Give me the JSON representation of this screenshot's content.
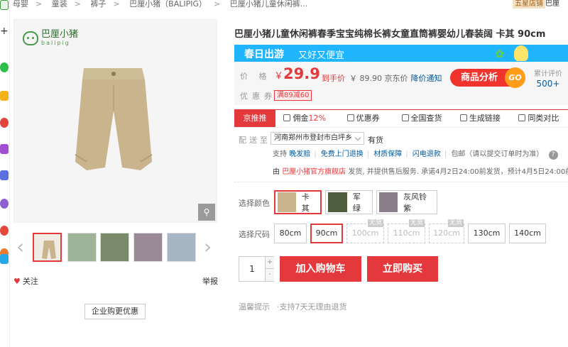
{
  "breadcrumb": [
    "母婴",
    "童装",
    "裤子",
    "巴厘小猪（BALIPIG）",
    "巴厘小猪儿童休闲裤..."
  ],
  "shop": {
    "badge": "五星店铺",
    "name": "巴厘"
  },
  "brand_logo": {
    "cn": "巴厘小猪",
    "en": "balipig"
  },
  "product": {
    "title": "巴厘小猪儿童休闲裤春季宝宝纯棉长裤女童直筒裤婴幼儿春装阔 卡其 90cm",
    "banner_main": "春日出游",
    "banner_sub": "又好又便宜",
    "price_label": "价 格",
    "currency": "￥",
    "price": "29.9",
    "hand_price_label": "到手价",
    "jd_price": "￥ 89.90 京东价",
    "price_notify": "降价通知",
    "coupon_label": "优惠券",
    "coupon": "满89减60",
    "analysis_label": "商品分析",
    "analysis_go": "GO",
    "review_label": "累计评价",
    "review_count": "500+"
  },
  "toolbar": [
    {
      "pre": "京推推",
      "hl": "",
      "icon": ""
    },
    {
      "pre": "佣金",
      "hl": "12%",
      "icon": "wallet-icon"
    },
    {
      "pre": "优惠券",
      "hl": "",
      "icon": "ticket-icon"
    },
    {
      "pre": "全国查货",
      "hl": "",
      "icon": "scan-icon"
    },
    {
      "pre": "生成链接",
      "hl": "",
      "icon": "link-icon"
    },
    {
      "pre": "同类对比",
      "hl": "",
      "icon": "compare-icon"
    }
  ],
  "shipping": {
    "label": "配送至",
    "address": "河南郑州市登封市白坪乡",
    "stock": "有货",
    "services": [
      "支持",
      "晚发赔",
      "免费上门退换",
      "材质保障",
      "闪电退款"
    ],
    "package": "包邮（请以提交订单时为准）",
    "help": "?",
    "promise_by": "由",
    "promise_shop": "巴厘小猪官方旗舰店",
    "promise_text": "发货, 并提供售后服务. 承诺4月2日24:00前发货，预计4月5日24:00前送达"
  },
  "colors": {
    "label": "选择颜色",
    "options": [
      {
        "label": "卡其",
        "swatch": "#c9b48e",
        "selected": true
      },
      {
        "label": "军绿",
        "swatch": "#4f5e3e",
        "selected": false
      },
      {
        "label": "灰风铃紫",
        "swatch": "#8c7d8a",
        "selected": false
      }
    ]
  },
  "sizes": {
    "label": "选择尺码",
    "options": [
      {
        "label": "80cm",
        "state": "normal"
      },
      {
        "label": "90cm",
        "state": "selected"
      },
      {
        "label": "100cm",
        "state": "disabled",
        "tag": "无货"
      },
      {
        "label": "110cm",
        "state": "disabled",
        "tag": "无货"
      },
      {
        "label": "120cm",
        "state": "disabled",
        "tag": "无货"
      },
      {
        "label": "130cm",
        "state": "normal"
      },
      {
        "label": "140cm",
        "state": "normal"
      }
    ]
  },
  "quantity": {
    "value": "1",
    "plus": "+",
    "minus": "-"
  },
  "actions": {
    "add_cart": "加入购物车",
    "buy_now": "立即购买"
  },
  "tips": {
    "label": "温馨提示",
    "text": "·支持7天无理由退货"
  },
  "gallery": {
    "follow": "关注",
    "report": "举报",
    "enterprise": "企业购更优惠",
    "prev": "‹",
    "next": "›",
    "zoom": "⚲"
  },
  "colors_theme": {
    "accent": "#e4393c",
    "banner": "#1fb5ff",
    "link": "#005aa0"
  }
}
